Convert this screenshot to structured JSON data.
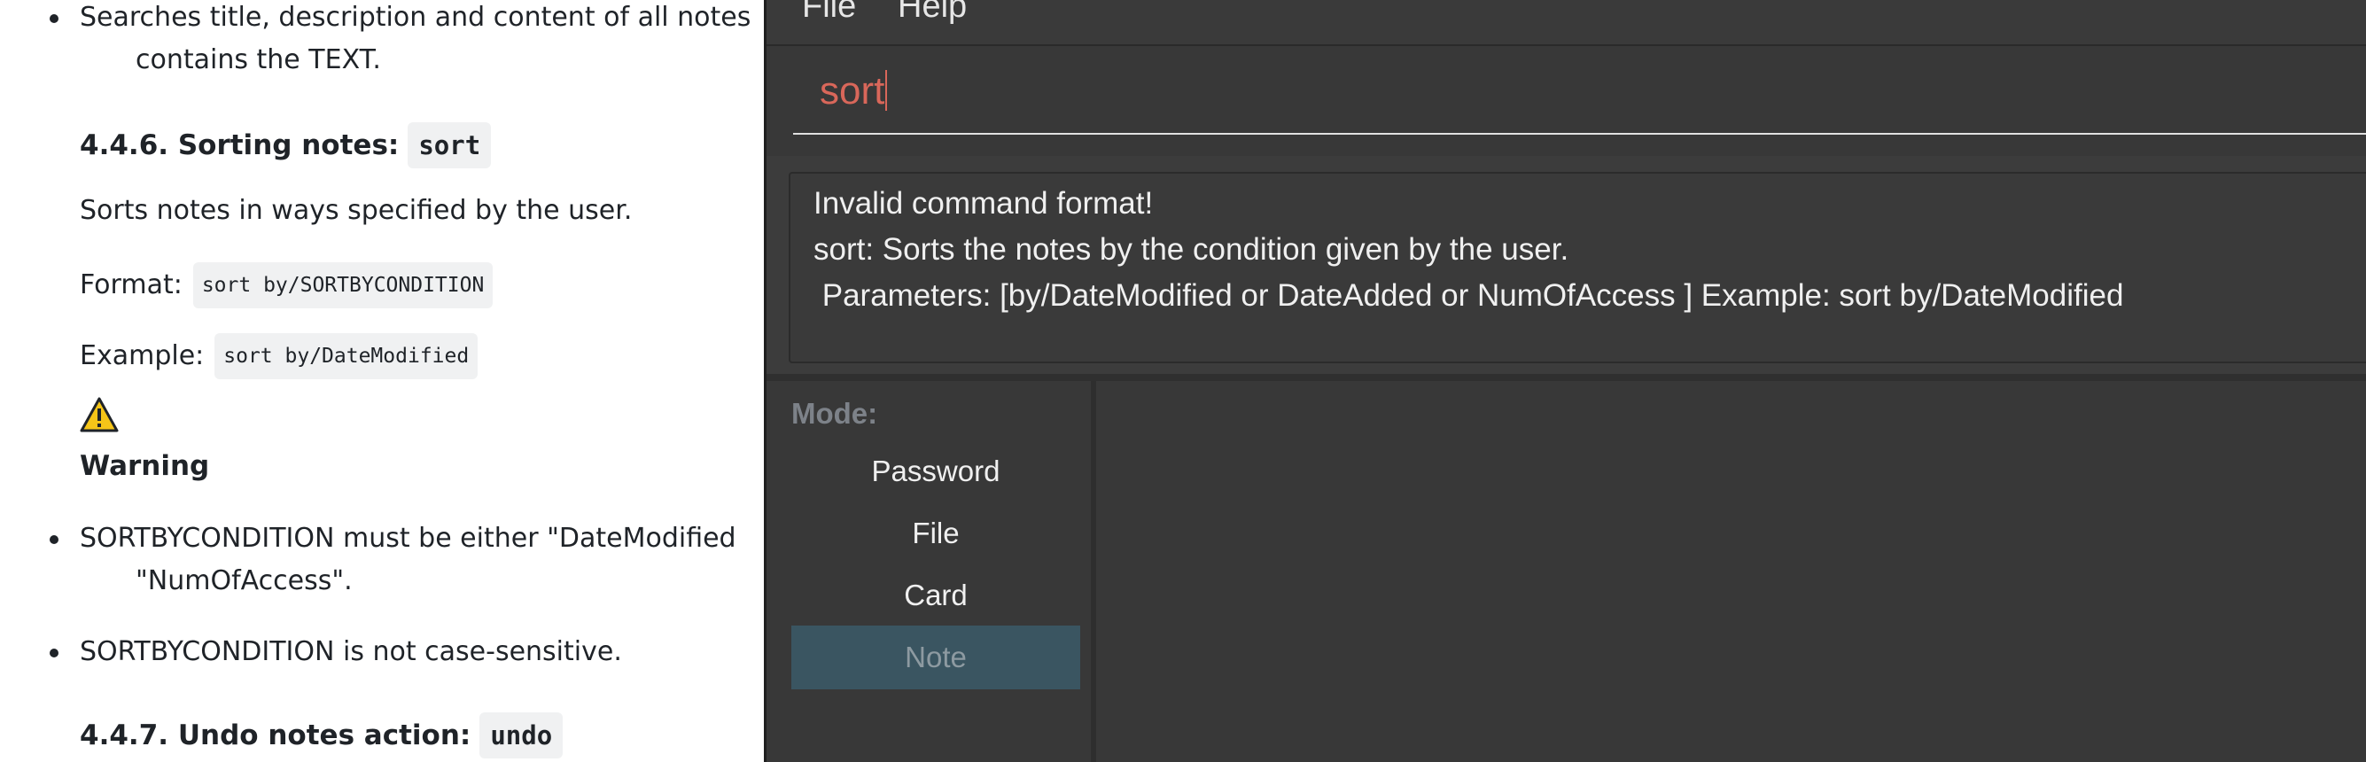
{
  "doc": {
    "bullet1_line1": "Searches title, description and content of all notes",
    "bullet1_line2": "contains the TEXT.",
    "section_sort_title": "4.4.6. Sorting notes:",
    "section_sort_code": "sort",
    "sort_desc": "Sorts notes in ways specified by the user.",
    "format_label": "Format:",
    "format_code": "sort by/SORTBYCONDITION",
    "example_label": "Example:",
    "example_code": "sort by/DateModified",
    "warning_title": "Warning",
    "warning_bullet1_line1": "SORTBYCONDITION must be either \"DateModified",
    "warning_bullet1_line2": "\"NumOfAccess\".",
    "warning_bullet2": "SORTBYCONDITION is not case-sensitive.",
    "section_undo_title": "4.4.7. Undo notes action:",
    "section_undo_code": "undo"
  },
  "app": {
    "menu": [
      "File",
      "Help"
    ],
    "command_input_value": "sort",
    "result_lines": [
      "Invalid command format!",
      "sort: Sorts the notes by the condition given by the user.",
      " Parameters: [by/DateModified or DateAdded or NumOfAccess ] Example: sort by/DateModified"
    ],
    "mode_label": "Mode:",
    "modes": [
      "Password",
      "File",
      "Card",
      "Note"
    ],
    "active_mode": "Note"
  },
  "colors": {
    "app_background": "#3c3c3c",
    "command_text": "#d9675a",
    "active_mode_bg": "#3a5561",
    "warning_icon": "#f5c518"
  }
}
